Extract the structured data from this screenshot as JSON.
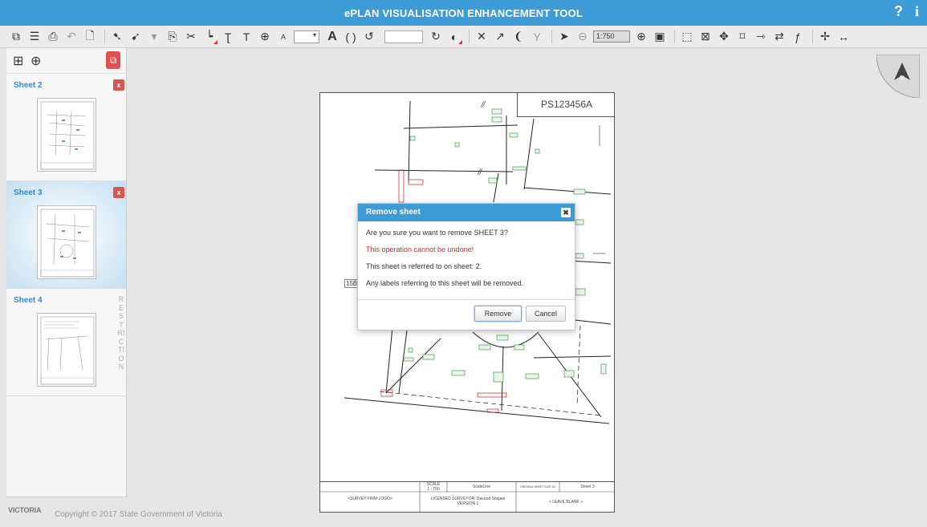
{
  "app": {
    "title": "ePLAN VISUALISATION ENHANCEMENT TOOL",
    "help": "?",
    "info": "i"
  },
  "toolbar": {
    "font_size_value": "▾",
    "scale_value": "1:750",
    "text_glyph": "A",
    "small_text_glyph": "A"
  },
  "sheets": [
    {
      "name": "Sheet 2",
      "delete": "x",
      "selected": false
    },
    {
      "name": "Sheet 3",
      "delete": "x",
      "selected": true
    },
    {
      "name": "Sheet 4",
      "badge": "RESTRICTION",
      "selected": false
    }
  ],
  "drawing": {
    "plan_number": "PS123456A",
    "side_label": "15B",
    "title_block": {
      "firm_logo": "<SURVEY FIRM LOGO>",
      "scale_label": "SCALE",
      "scale_value": "1 : 750",
      "scale_line": "ScaleLine",
      "sheet_size": "ORIGINAL SHEET SIZE: A3",
      "sheet": "Sheet 3",
      "surveyor": "LICENSED SURVEYOR: Davood Shojaei",
      "version": "VERSION 1",
      "leave_blank": "< LEAVE BLANK >"
    }
  },
  "north_arrow": {
    "label": "N"
  },
  "dialog": {
    "title": "Remove sheet",
    "close": "✖",
    "question": "Are you sure you want to remove SHEET 3?",
    "warning": "This operation cannot be undone!",
    "reference": "This sheet is referred to on sheet: 2.",
    "labels_note": "Any labels referring to this sheet will be removed.",
    "remove_label": "Remove",
    "cancel_label": "Cancel"
  },
  "footer": {
    "logo": "VICTORIA",
    "copyright": "Copyright © 2017 State Government of Victoria"
  },
  "colors": {
    "titlebar": "#3d9cd6",
    "danger": "#d9534f",
    "warning_text": "#d62a2a",
    "sheet_link": "#3d86c4"
  }
}
